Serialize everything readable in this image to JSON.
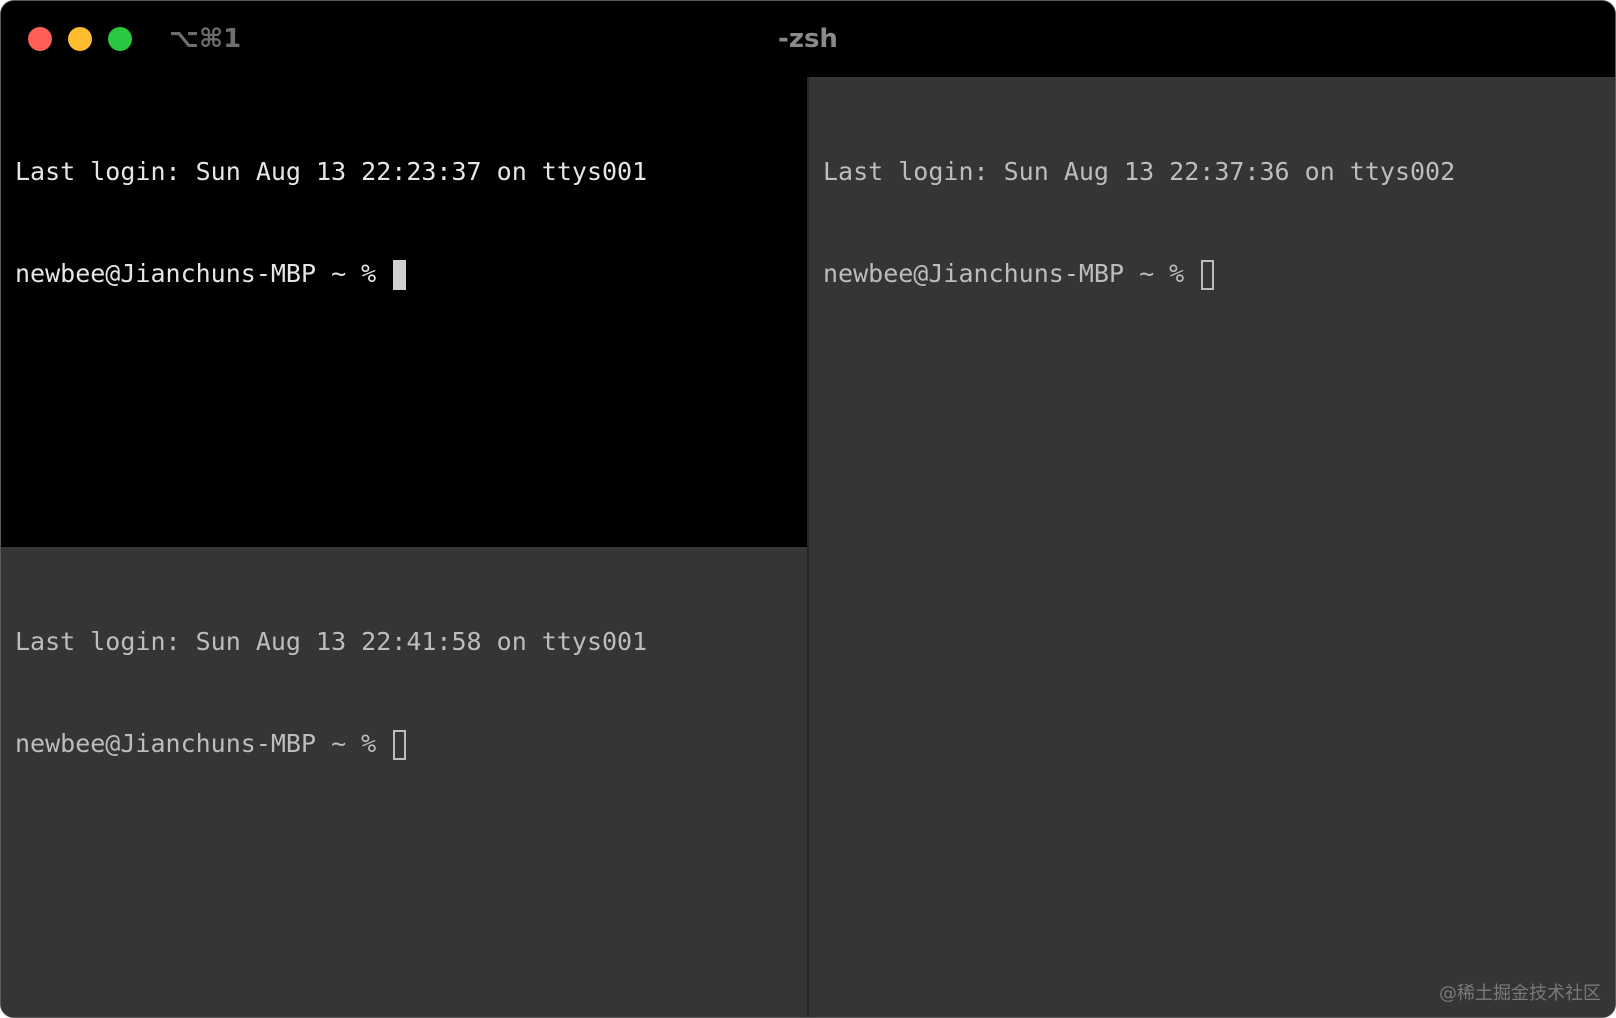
{
  "window": {
    "shortcut": "⌥⌘1",
    "title": "-zsh"
  },
  "panes": {
    "top_left": {
      "last_login": "Last login: Sun Aug 13 22:23:37 on ttys001",
      "prompt": "newbee@Jianchuns-MBP ~ % "
    },
    "bottom_left": {
      "last_login": "Last login: Sun Aug 13 22:41:58 on ttys001",
      "prompt": "newbee@Jianchuns-MBP ~ % "
    },
    "right": {
      "last_login": "Last login: Sun Aug 13 22:37:36 on ttys002",
      "prompt": "newbee@Jianchuns-MBP ~ % "
    }
  },
  "watermark": "@稀土掘金技术社区",
  "colors": {
    "close": "#fe5f57",
    "minimize": "#febc2e",
    "zoom": "#28c840",
    "active_pane_bg": "#000000",
    "inactive_pane_bg": "#353535"
  }
}
